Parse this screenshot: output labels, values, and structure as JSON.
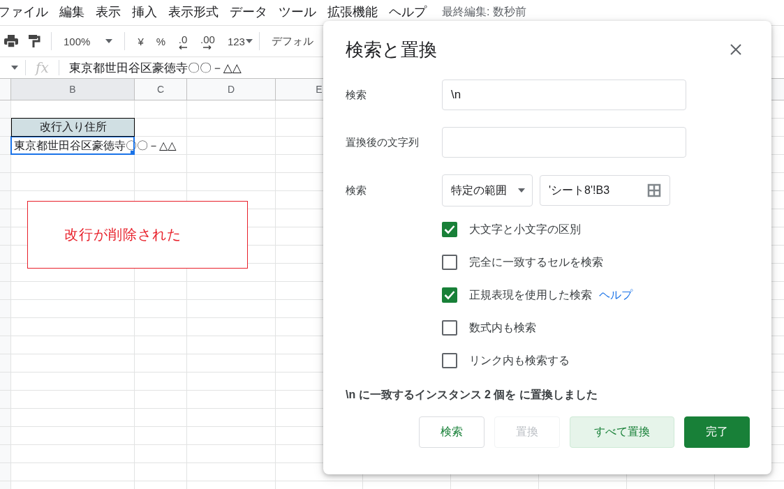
{
  "menu": [
    "ファイル",
    "編集",
    "表示",
    "挿入",
    "表示形式",
    "データ",
    "ツール",
    "拡張機能",
    "ヘルプ"
  ],
  "last_edit": "最終編集: 数秒前",
  "toolbar": {
    "zoom": "100%",
    "formats": [
      "¥",
      "%",
      ".0",
      ".00",
      "123"
    ],
    "font": "デフォル"
  },
  "formula_bar": {
    "fx": "fx",
    "value": "東京都世田谷区豪徳寺〇〇－△△"
  },
  "columns": [
    "B",
    "C",
    "D",
    "E"
  ],
  "cells": [
    {
      "kind": "header",
      "text": "改行入り住所",
      "selected": false
    },
    {
      "kind": "value",
      "text": "東京都世田谷区豪徳寺〇〇－△△",
      "selected": true
    }
  ],
  "annotation": "改行が削除された",
  "dialog": {
    "title": "検索と置換",
    "fields": [
      {
        "label": "検索",
        "value": "\\n"
      },
      {
        "label": "置換後の文字列"
      }
    ],
    "scope": {
      "label": "検索",
      "dropdown": "特定の範囲",
      "range": "'シート8'!B3"
    },
    "options": [
      {
        "label": "大文字と小文字の区別",
        "checked": true
      },
      {
        "label": "完全に一致するセルを検索",
        "checked": false
      },
      {
        "label": "正規表現を使用した検索",
        "checked": true,
        "link": "ヘルプ"
      },
      {
        "label": "数式内も検索",
        "checked": false
      },
      {
        "label": "リンク内も検索する",
        "checked": false
      }
    ],
    "status": "\\n に一致するインスタンス 2 個を に置換しました",
    "buttons": [
      {
        "label": "検索",
        "kind": "outlined"
      },
      {
        "label": "置換",
        "kind": "disabled"
      },
      {
        "label": "すべて置換",
        "kind": "tonal"
      },
      {
        "label": "完了",
        "kind": "filled"
      }
    ]
  }
}
